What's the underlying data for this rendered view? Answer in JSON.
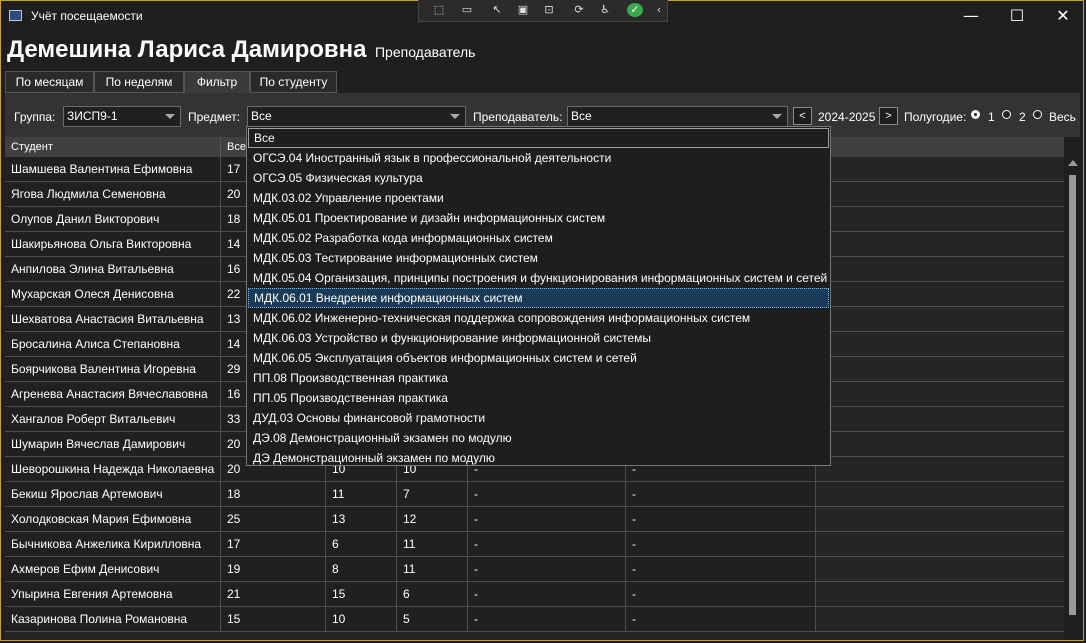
{
  "window": {
    "title": "Учёт посещаемости",
    "minimize": "—",
    "maximize": "☐",
    "close": "✕"
  },
  "header": {
    "name": "Демешина Лариса Дамировна",
    "role": "Преподаватель"
  },
  "tabs": [
    {
      "label": "По месяцам",
      "active": false
    },
    {
      "label": "По неделям",
      "active": false
    },
    {
      "label": "Фильтр",
      "active": true
    },
    {
      "label": "По студенту",
      "active": false
    }
  ],
  "filters": {
    "group_label": "Группа:",
    "group_value": "ЗИСП9-1",
    "subject_label": "Предмет:",
    "subject_value": "Все",
    "teacher_label": "Преподаватель:",
    "teacher_value": "Все",
    "prev": "<",
    "year": "2024-2025",
    "next": ">",
    "semester_label": "Полугодие:",
    "semester_1": "1",
    "semester_2": "2",
    "semester_all": "Весь г",
    "semester_selected": "1"
  },
  "grid": {
    "columns": [
      "Студент",
      "Все"
    ],
    "rows": [
      {
        "name": "Шамшева Валентина Ефимовна",
        "c1": "17",
        "c2": "",
        "c3": "",
        "c4": "",
        "c5": ""
      },
      {
        "name": "Ягова Людмила Семеновна",
        "c1": "20",
        "c2": "",
        "c3": "",
        "c4": "",
        "c5": ""
      },
      {
        "name": "Олупов Данил Викторович",
        "c1": "18",
        "c2": "",
        "c3": "",
        "c4": "",
        "c5": ""
      },
      {
        "name": "Шакирьянова Ольга Викторовна",
        "c1": "14",
        "c2": "",
        "c3": "",
        "c4": "",
        "c5": ""
      },
      {
        "name": "Анпилова Элина Витальевна",
        "c1": "16",
        "c2": "",
        "c3": "",
        "c4": "",
        "c5": ""
      },
      {
        "name": "Мухарская Олеся Денисовна",
        "c1": "22",
        "c2": "",
        "c3": "",
        "c4": "",
        "c5": ""
      },
      {
        "name": "Шехватова Анастасия Витальевна",
        "c1": "13",
        "c2": "",
        "c3": "",
        "c4": "",
        "c5": ""
      },
      {
        "name": "Бросалина Алиса Степановна",
        "c1": "14",
        "c2": "",
        "c3": "",
        "c4": "",
        "c5": ""
      },
      {
        "name": "Боярчикова Валентина Игоревна",
        "c1": "29",
        "c2": "",
        "c3": "",
        "c4": "",
        "c5": ""
      },
      {
        "name": "Агренева Анастасия Вячеславовна",
        "c1": "16",
        "c2": "",
        "c3": "",
        "c4": "",
        "c5": ""
      },
      {
        "name": "Хангалов Роберт Витальевич",
        "c1": "33",
        "c2": "",
        "c3": "",
        "c4": "",
        "c5": ""
      },
      {
        "name": "Шумарин Вячеслав Дамирович",
        "c1": "20",
        "c2": "",
        "c3": "",
        "c4": "",
        "c5": ""
      },
      {
        "name": "Шеворошкина Надежда Николаевна",
        "c1": "20",
        "c2": "10",
        "c3": "10",
        "c4": "-",
        "c5": "-"
      },
      {
        "name": "Бекиш Ярослав Артемович",
        "c1": "18",
        "c2": "11",
        "c3": "7",
        "c4": "-",
        "c5": "-"
      },
      {
        "name": "Холодковская Мария Ефимовна",
        "c1": "25",
        "c2": "13",
        "c3": "12",
        "c4": "-",
        "c5": "-"
      },
      {
        "name": "Бычникова Анжелика Кирилловна",
        "c1": "17",
        "c2": "6",
        "c3": "11",
        "c4": "-",
        "c5": "-"
      },
      {
        "name": "Ахмеров Ефим Денисович",
        "c1": "19",
        "c2": "8",
        "c3": "11",
        "c4": "-",
        "c5": "-"
      },
      {
        "name": "Упырина Евгения Артемовна",
        "c1": "21",
        "c2": "15",
        "c3": "6",
        "c4": "-",
        "c5": "-"
      },
      {
        "name": "Казаринова Полина Романовна",
        "c1": "15",
        "c2": "10",
        "c3": "5",
        "c4": "-",
        "c5": "-"
      }
    ]
  },
  "dropdown": {
    "highlighted_index": 8,
    "items": [
      "Все",
      "ОГСЭ.04 Иностранный язык в профессиональной деятельности",
      "ОГСЭ.05 Физическая культура",
      "МДК.03.02 Управление проектами",
      "МДК.05.01 Проектирование и дизайн информационных систем",
      "МДК.05.02 Разработка кода информационных систем",
      "МДК.05.03 Тестирование информационных систем",
      "МДК.05.04 Организация, принципы построения и функционирования информационных систем и сетей",
      "МДК.06.01 Внедрение информационных систем",
      "МДК.06.02 Инженерно-техническая поддержка сопровождения информационных систем",
      "МДК.06.03 Устройство и функционирование информационной системы",
      "МДК.06.05 Эксплуатация объектов информационных систем и сетей",
      "ПП.08 Производственная практика",
      "ПП.05 Производственная практика",
      "ДУД.03 Основы финансовой грамотности",
      "ДЭ.08 Демонстрационный экзамен по модулю",
      "ДЭ Демонстрационный экзамен по модулю"
    ]
  },
  "debug_toolbar": {
    "icons": [
      "select-element-icon",
      "record-icon",
      "pointer-icon",
      "frame-icon",
      "screenshot-icon",
      "hot-reload-icon",
      "accessibility-icon",
      "check-icon",
      "collapse-icon"
    ]
  }
}
